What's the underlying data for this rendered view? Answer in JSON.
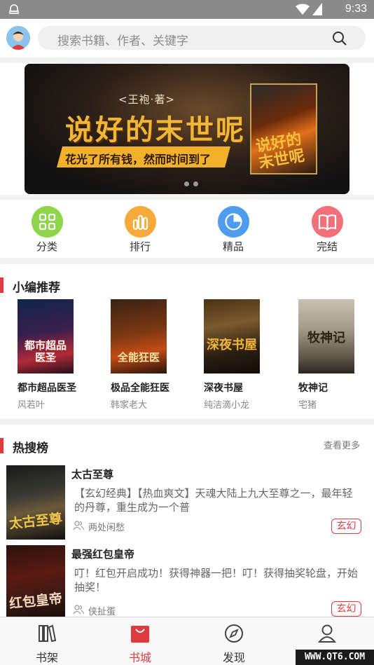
{
  "status_bar": {
    "time": "9:33"
  },
  "header": {
    "search_placeholder": "搜索书籍、作者、关键字"
  },
  "banner": {
    "author": "<王袍·著>",
    "title": "说好的末世呢",
    "tagline": "花光了所有钱，然而时间到了",
    "cover_title": "说好的末世呢",
    "page_count": 2
  },
  "categories": [
    {
      "label": "分类",
      "icon": "grid-icon",
      "color": "#8dd54b"
    },
    {
      "label": "排行",
      "icon": "bars-icon",
      "color": "#f7a93a"
    },
    {
      "label": "精品",
      "icon": "pie-icon",
      "color": "#4f9bef"
    },
    {
      "label": "完结",
      "icon": "book-icon",
      "color": "#f2707a"
    }
  ],
  "recommend": {
    "title": "小编推荐",
    "books": [
      {
        "title": "都市超品医圣",
        "author": "风若叶",
        "cover_text": "都市超品医圣"
      },
      {
        "title": "极品全能狂医",
        "author": "韩家老大",
        "cover_text": "全能狂医"
      },
      {
        "title": "深夜书屋",
        "author": "纯洁滴小龙",
        "cover_text": "深夜书屋"
      },
      {
        "title": "牧神记",
        "author": "宅猪",
        "cover_text": "牧神记"
      }
    ]
  },
  "hot": {
    "title": "热搜榜",
    "more": "查看更多",
    "items": [
      {
        "title": "太古至尊",
        "desc": "【玄幻经典】【热血爽文】天魂大陆上九大至尊之一，最年轻的丹尊，重生成为一个普",
        "author": "两处闲愁",
        "badge": "玄幻",
        "cover_text": "太古至尊"
      },
      {
        "title": "最强红包皇帝",
        "desc": "叮！红包开启成功！获得神器一把！叮！获得抽奖轮盘，开始抽奖！",
        "author": "侠扯蛋",
        "badge": "玄幻",
        "cover_text": "红包皇帝"
      }
    ]
  },
  "tabs": [
    {
      "label": "书架",
      "icon": "bookshelf-icon",
      "active": false
    },
    {
      "label": "书城",
      "icon": "bag-icon",
      "active": true
    },
    {
      "label": "发现",
      "icon": "compass-icon",
      "active": false
    },
    {
      "label": "我的",
      "icon": "user-icon",
      "active": false
    }
  ],
  "watermark": "WWW.QT6.COM",
  "colors": {
    "accent": "#e0393e"
  }
}
